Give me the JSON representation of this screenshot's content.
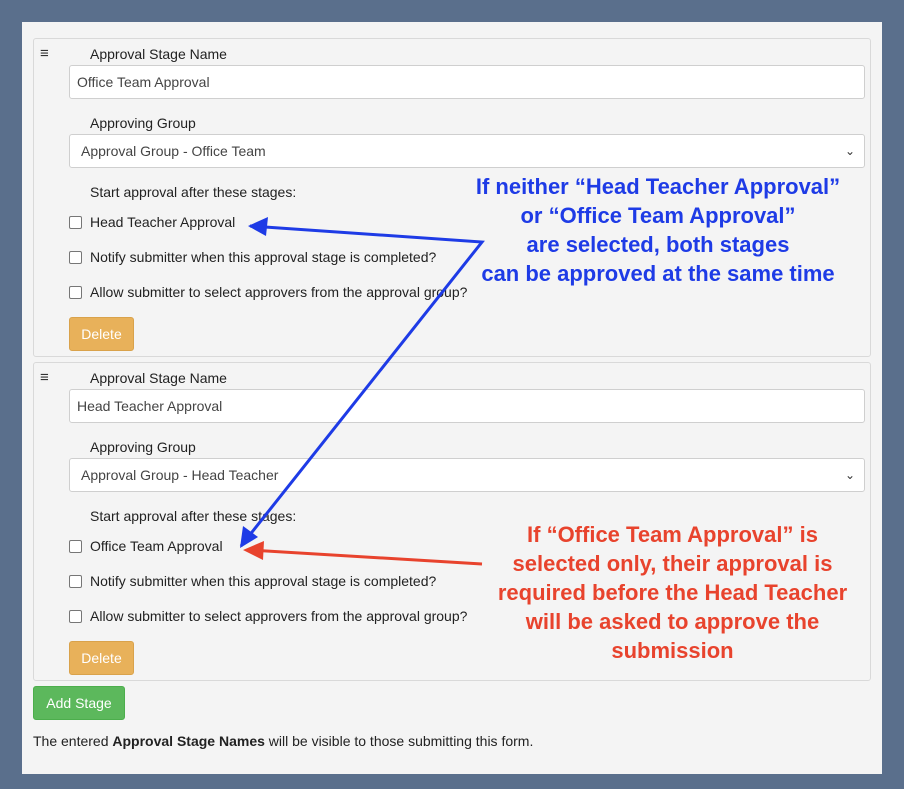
{
  "stages": [
    {
      "name_label": "Approval Stage Name",
      "name_value": "Office Team Approval",
      "group_label": "Approving Group",
      "group_value": "Approval Group - Office Team",
      "after_label": "Start approval after these stages:",
      "after_option": "Head Teacher Approval",
      "notify_label": "Notify submitter when this approval stage is completed?",
      "allow_label": "Allow submitter to select approvers from the approval group?",
      "delete_label": "Delete"
    },
    {
      "name_label": "Approval Stage Name",
      "name_value": "Head Teacher Approval",
      "group_label": "Approving Group",
      "group_value": "Approval Group - Head Teacher",
      "after_label": "Start approval after these stages:",
      "after_option": "Office Team Approval",
      "notify_label": "Notify submitter when this approval stage is completed?",
      "allow_label": "Allow submitter to select approvers from the approval group?",
      "delete_label": "Delete"
    }
  ],
  "add_stage_label": "Add Stage",
  "footnote": {
    "pre": "The entered ",
    "bold": "Approval Stage Names",
    "post": " will be visible to those submitting this form."
  },
  "annotations": {
    "blue": {
      "color": "#1e3be6",
      "lines": [
        "If neither “Head Teacher Approval”",
        "or “Office Team Approval”",
        "are selected, both stages",
        "can be approved at the same time"
      ]
    },
    "red": {
      "color": "#e8432d",
      "lines": [
        "If “Office Team Approval” is",
        "selected only, their approval is",
        "required before the Head Teacher",
        "will be asked to approve the",
        "submission"
      ]
    }
  },
  "icons": {
    "drag": "≡",
    "chevron": "⌄"
  },
  "colors": {
    "frame": "#5a6f8c",
    "delete_button": "#e8b15a",
    "add_button": "#5cb85c"
  }
}
